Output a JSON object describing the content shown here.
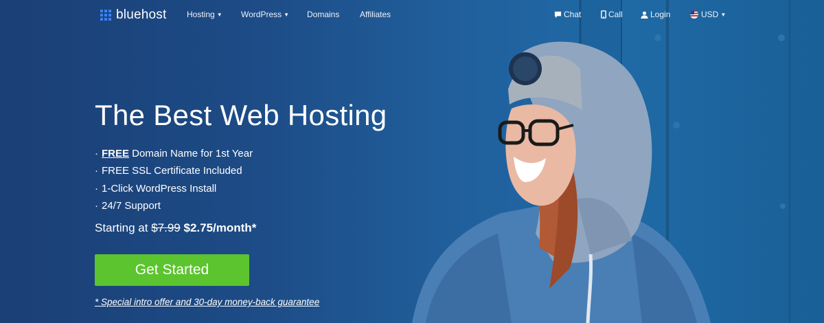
{
  "brand": {
    "name": "bluehost",
    "accent": "#3b82f6"
  },
  "nav": {
    "left": [
      {
        "label": "Hosting",
        "has_dropdown": true
      },
      {
        "label": "WordPress",
        "has_dropdown": true
      },
      {
        "label": "Domains",
        "has_dropdown": false
      },
      {
        "label": "Affiliates",
        "has_dropdown": false
      }
    ],
    "right": [
      {
        "label": "Chat",
        "icon": "chat-icon"
      },
      {
        "label": "Call",
        "icon": "phone-icon"
      },
      {
        "label": "Login",
        "icon": "user-icon"
      },
      {
        "label": "USD",
        "icon": "us-flag-icon",
        "has_dropdown": true
      }
    ]
  },
  "hero": {
    "headline": "The Best Web Hosting",
    "bullet_char": "·",
    "features": [
      {
        "strong": "FREE",
        "text": " Domain Name for 1st Year"
      },
      {
        "strong": "",
        "text": "FREE SSL Certificate Included"
      },
      {
        "strong": "",
        "text": "1-Click WordPress Install"
      },
      {
        "strong": "",
        "text": "24/7 Support"
      }
    ],
    "price": {
      "prefix": "Starting at ",
      "old": "$7.99",
      "new": "$2.75/month*"
    },
    "cta_label": "Get Started",
    "cta_color": "#5bc42e",
    "guarantee": "* Special intro offer and 30-day money-back guarantee"
  },
  "colors": {
    "background_left": "#1b3f76",
    "background_right": "#1f6aa6",
    "hood": "#8fa5c0",
    "jacket": "#4a7fb5"
  }
}
